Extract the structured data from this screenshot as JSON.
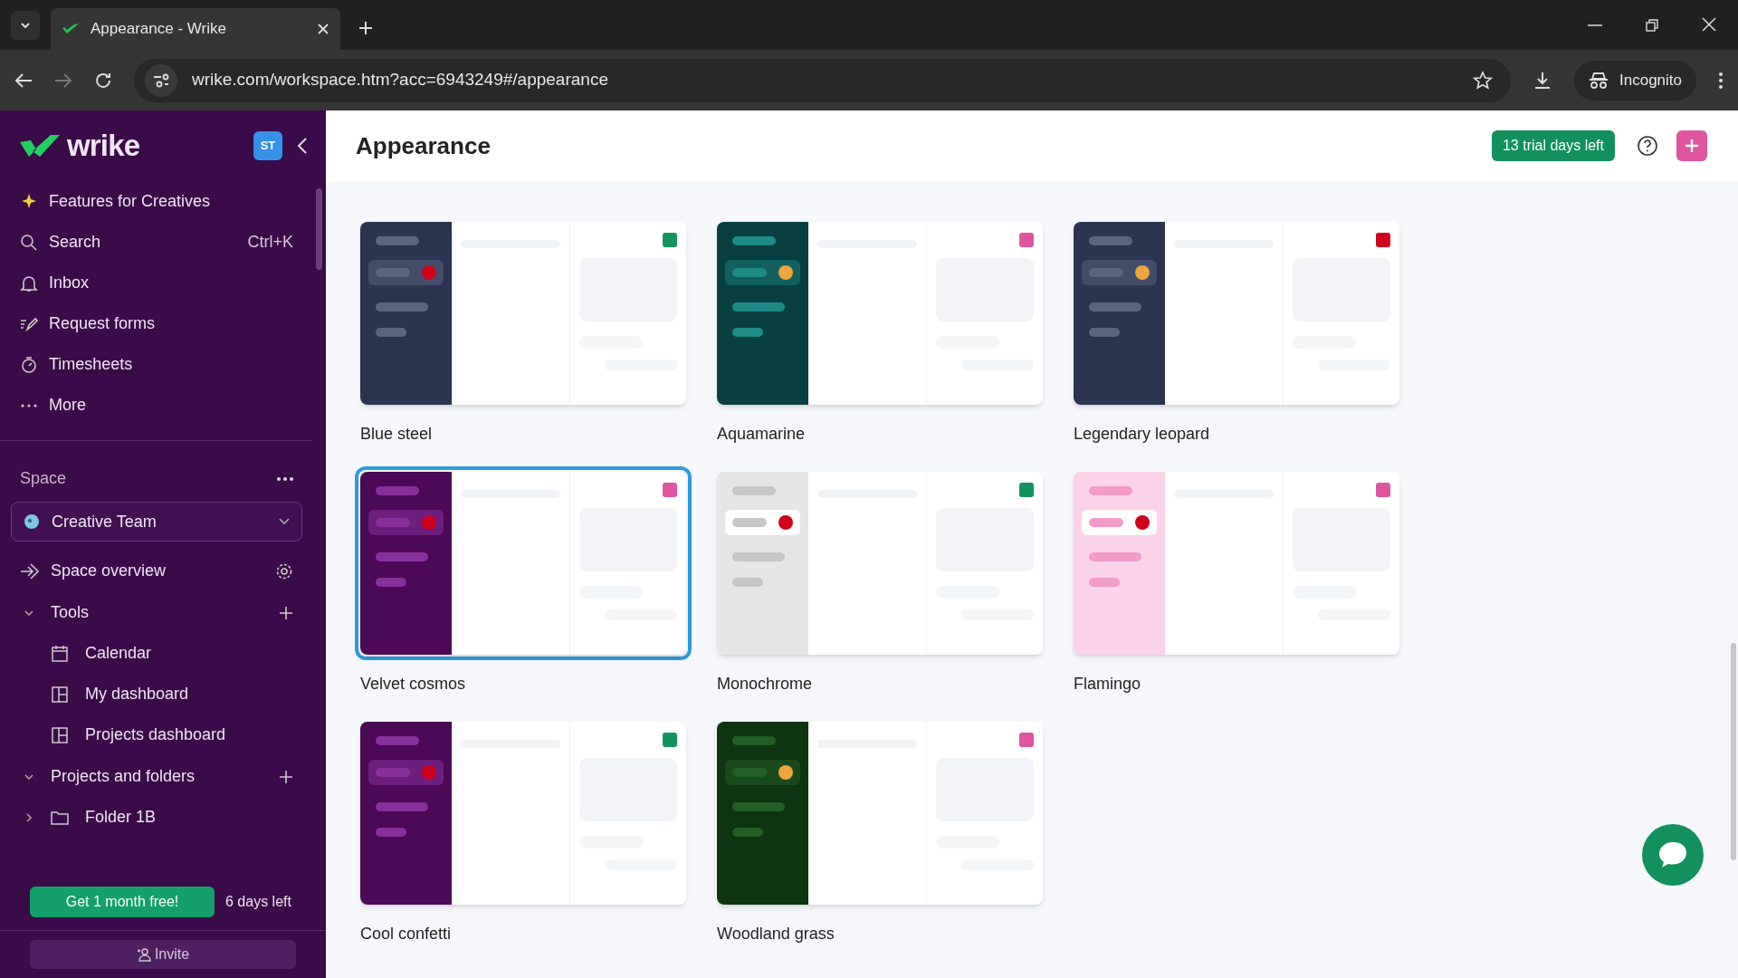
{
  "browser": {
    "tab_title": "Appearance - Wrike",
    "url": "wrike.com/workspace.htm?acc=6943249#/appearance",
    "profile": "Incognito"
  },
  "sidebar": {
    "logo": "wrike",
    "avatar": "ST",
    "nav": [
      {
        "label": "Features for Creatives"
      },
      {
        "label": "Search",
        "shortcut": "Ctrl+K"
      },
      {
        "label": "Inbox"
      },
      {
        "label": "Request forms"
      },
      {
        "label": "Timesheets"
      },
      {
        "label": "More"
      }
    ],
    "space_label": "Space",
    "space_selector": "Creative Team",
    "space_overview": "Space overview",
    "sections": [
      {
        "title": "Tools",
        "expanded": true,
        "children": [
          {
            "label": "Calendar"
          },
          {
            "label": "My dashboard"
          },
          {
            "label": "Projects dashboard"
          }
        ]
      },
      {
        "title": "Projects and folders",
        "expanded": true,
        "children": [
          {
            "label": "Folder 1B",
            "expanded": false
          }
        ]
      }
    ],
    "promo_button": "Get 1 month free!",
    "days_left": "6 days left",
    "invite": "Invite"
  },
  "header": {
    "title": "Appearance",
    "trial_badge": "13 trial days left"
  },
  "themes": [
    {
      "name": "Blue steel",
      "selected": false,
      "preview": {
        "sidebar": {
          "color": "#2b3552"
        },
        "pill": {
          "color": "#5a6582"
        },
        "active_row": {
          "color": "#434d6a"
        },
        "dot": {
          "color": "#d0021b"
        },
        "accent": {
          "color": "#12945e"
        }
      }
    },
    {
      "name": "Aquamarine",
      "selected": false,
      "preview": {
        "sidebar": {
          "color": "#083f40"
        },
        "pill": {
          "color": "#1d8a86"
        },
        "active_row": {
          "color": "#11605f"
        },
        "dot": {
          "color": "#f0a43c"
        },
        "accent": {
          "color": "#e0559f"
        }
      }
    },
    {
      "name": "Legendary leopard",
      "selected": false,
      "preview": {
        "sidebar": {
          "color": "#2b3552"
        },
        "pill": {
          "color": "#5a6582"
        },
        "active_row": {
          "color": "#434d6a"
        },
        "dot": {
          "color": "#f0a43c"
        },
        "accent": {
          "color": "#d0021b"
        }
      }
    },
    {
      "name": "Velvet cosmos",
      "selected": true,
      "preview": {
        "sidebar": {
          "color": "#4a0a55"
        },
        "pill": {
          "color": "#86309a"
        },
        "active_row": {
          "color": "#6c1f7c"
        },
        "dot": {
          "color": "#d0021b"
        },
        "accent": {
          "color": "#e0559f"
        }
      }
    },
    {
      "name": "Monochrome",
      "selected": false,
      "preview": {
        "sidebar": {
          "color": "#e6e6e6"
        },
        "pill": {
          "color": "#c6c6c6"
        },
        "active_row": {
          "color": "#ffffff"
        },
        "dot": {
          "color": "#d0021b"
        },
        "accent": {
          "color": "#12945e"
        }
      }
    },
    {
      "name": "Flamingo",
      "selected": false,
      "preview": {
        "sidebar": {
          "color": "#fcd3ea"
        },
        "pill": {
          "color": "#f29ac8"
        },
        "active_row": {
          "color": "#ffffff"
        },
        "dot": {
          "color": "#d0021b"
        },
        "accent": {
          "color": "#e0559f"
        }
      }
    },
    {
      "name": "Cool confetti",
      "selected": false,
      "preview": {
        "sidebar": {
          "color": "#4a0a55"
        },
        "pill": {
          "color": "#86309a"
        },
        "active_row": {
          "color": "#6c1f7c"
        },
        "dot": {
          "color": "#d0021b"
        },
        "accent": {
          "color": "#12945e"
        }
      }
    },
    {
      "name": "Woodland grass",
      "selected": false,
      "preview": {
        "sidebar": {
          "color": "#0c3510"
        },
        "pill": {
          "color": "#215f24"
        },
        "active_row": {
          "color": "#184a1b"
        },
        "dot": {
          "color": "#f0a43c"
        },
        "accent": {
          "color": "#e0559f"
        }
      }
    }
  ]
}
